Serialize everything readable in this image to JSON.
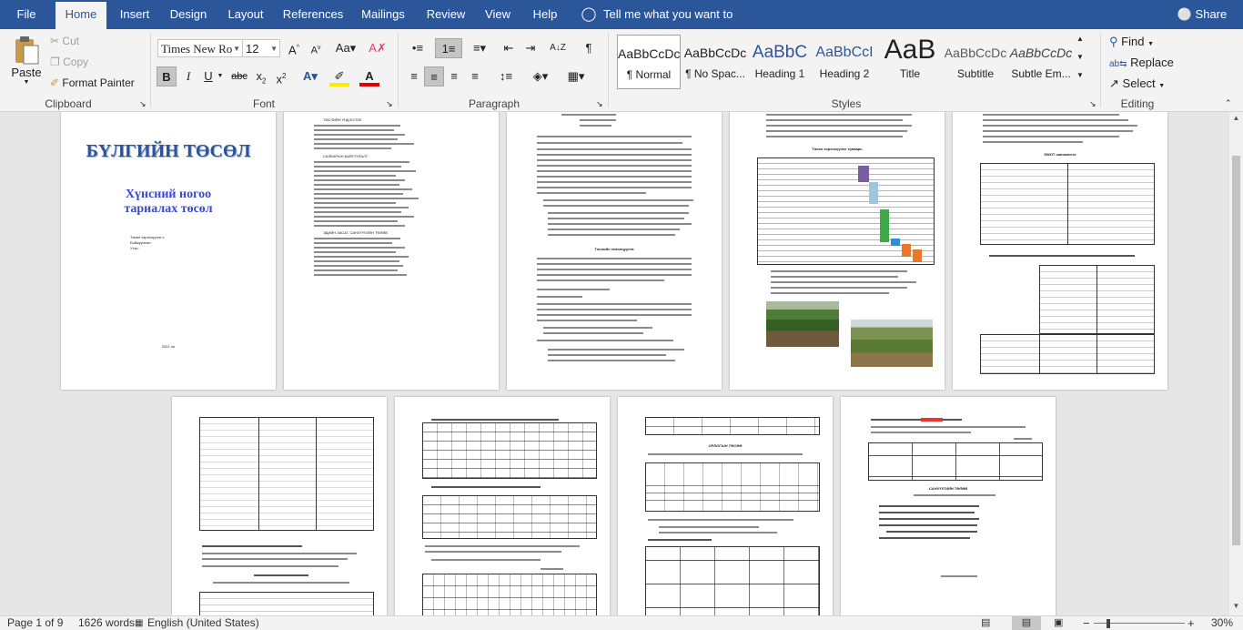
{
  "tabs": [
    "File",
    "Home",
    "Insert",
    "Design",
    "Layout",
    "References",
    "Mailings",
    "Review",
    "View",
    "Help"
  ],
  "tell_me": "Tell me what you want to do",
  "share": "Share",
  "clipboard": {
    "paste": "Paste",
    "cut": "Cut",
    "copy": "Copy",
    "format_painter": "Format Painter",
    "label": "Clipboard"
  },
  "font": {
    "name": "Times New Ro",
    "size": "12",
    "label": "Font"
  },
  "paragraph": {
    "label": "Paragraph"
  },
  "styles": {
    "label": "Styles",
    "items": [
      {
        "preview": "AaBbCcDc",
        "name": "¶ Normal"
      },
      {
        "preview": "AaBbCcDc",
        "name": "¶ No Spac..."
      },
      {
        "preview": "AaBbC",
        "name": "Heading 1"
      },
      {
        "preview": "AaBbCcI",
        "name": "Heading 2"
      },
      {
        "preview": "AaB",
        "name": "Title"
      },
      {
        "preview": "AaBbCcDc",
        "name": "Subtitle"
      },
      {
        "preview": "AaBbCcDc",
        "name": "Subtle Em..."
      }
    ]
  },
  "editing": {
    "find": "Find",
    "replace": "Replace",
    "select": "Select",
    "label": "Editing"
  },
  "document": {
    "cover_title": "БҮЛГИЙН ТӨСӨЛ",
    "cover_subtitle_1": "Хүнсний ногоо",
    "cover_subtitle_2": "тариалах төсөл",
    "cover_fields": [
      "Төсөл хэрэгжүүлэгч:",
      "Бойжуулсан:",
      "Утас:"
    ],
    "cover_year": "2021 он",
    "p2_head_1": "ТӨСЛИЙН ҮНДЭСЛЭЛ",
    "p2_head_2": "САЛБАРЫН БАЙГУУЛАЛТ",
    "p2_head_3": "ЭДИЙН ЗАСАГ, САНХҮҮГИЙН ТӨЛӨВ",
    "p3_title": "Төслийн танилцуулга",
    "p4_table_title": "Төсөл хэрэгжүүлэх хуваарь",
    "p5_title": "SWOT шинжилгээ",
    "p8_title": "ОРЛОГЫН ТӨСӨӨ",
    "p9_title": "САНХҮҮГИЙН ТӨЛӨВ"
  },
  "status": {
    "page": "Page 1 of 9",
    "words": "1626 words",
    "language": "English (United States)",
    "zoom": "30%"
  }
}
